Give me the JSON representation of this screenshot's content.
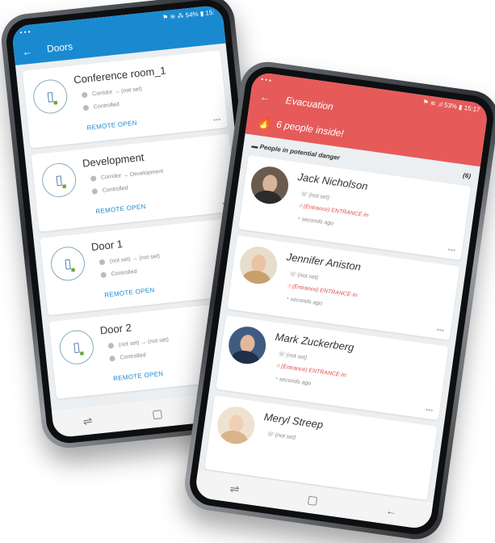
{
  "phone_left": {
    "status": {
      "left": "• • ▪",
      "right": "⚑ ≋ ⁂ 54% ▮ 15:"
    },
    "title": "Doors",
    "back_icon": "←",
    "doors": [
      {
        "name": "Conference room_1",
        "route": "Corridor → (not set)",
        "mode": "Controlled",
        "action": "REMOTE OPEN",
        "more": "•••"
      },
      {
        "name": "Development",
        "route": "Corridor → Development",
        "mode": "Controlled",
        "action": "REMOTE OPEN",
        "more": "•••"
      },
      {
        "name": "Door 1",
        "route": "(not set) → (not set)",
        "mode": "Controlled",
        "action": "REMOTE OPEN",
        "more": "•••"
      },
      {
        "name": "Door 2",
        "route": "(not set) → (not set)",
        "mode": "Controlled",
        "action": "REMOTE OPEN",
        "more": "•••"
      }
    ],
    "nav": {
      "recent": "⇌",
      "home": "▢",
      "back": "←"
    },
    "colors": {
      "accent": "#1a8ad0"
    }
  },
  "phone_right": {
    "status": {
      "left": "▪ • ▪",
      "right": "⚑ ≋ .ıl 53% ▮ 15:17"
    },
    "title": "Evacuation",
    "back_icon": "←",
    "inside": "6 people inside!",
    "section": {
      "title": "People in potential danger",
      "count": "(6)"
    },
    "people": [
      {
        "name": "Jack  Nicholson",
        "phone": "(not set)",
        "location": "(Entrance) ENTRANCE-In",
        "time": "seconds ago",
        "more": "•••"
      },
      {
        "name": "Jennifer Aniston",
        "phone": "(not set)",
        "location": "(Entrance) ENTRANCE-In",
        "time": "seconds ago",
        "more": "•••"
      },
      {
        "name": "Mark Zuckerberg",
        "phone": "(not set)",
        "location": "(Entrance) ENTRANCE-In",
        "time": "seconds ago",
        "more": "•••"
      },
      {
        "name": "Meryl Streep",
        "phone": "(not set)"
      }
    ],
    "nav": {
      "recent": "⇌",
      "home": "▢",
      "back": "←"
    },
    "colors": {
      "accent": "#e65a5a"
    }
  }
}
